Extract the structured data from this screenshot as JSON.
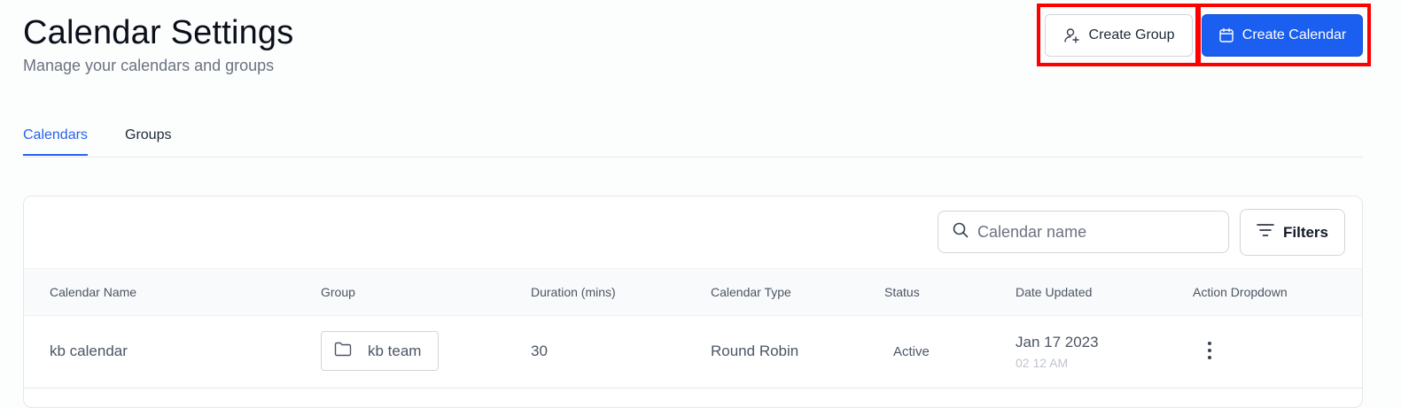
{
  "header": {
    "title": "Calendar Settings",
    "subtitle": "Manage your calendars and groups",
    "create_group_label": "Create Group",
    "create_calendar_label": "Create Calendar"
  },
  "tabs": [
    {
      "label": "Calendars",
      "active": true
    },
    {
      "label": "Groups",
      "active": false
    }
  ],
  "toolbar": {
    "search_placeholder": "Calendar name",
    "filters_label": "Filters"
  },
  "table": {
    "columns": [
      "Calendar Name",
      "Group",
      "Duration (mins)",
      "Calendar Type",
      "Status",
      "Date Updated",
      "Action Dropdown"
    ],
    "rows": [
      {
        "name": "kb calendar",
        "group": "kb team",
        "duration": "30",
        "type": "Round Robin",
        "status": "Active",
        "date": "Jan 17 2023",
        "time": "02 12 AM"
      }
    ]
  },
  "colors": {
    "primary": "#1a5ff0",
    "highlight": "#ff0000",
    "active_tab": "#2563eb"
  },
  "icons": {
    "create_group": "user-plus-icon",
    "create_calendar": "calendar-icon",
    "search": "search-icon",
    "filters": "filter-lines-icon",
    "group": "folder-icon",
    "actions": "kebab-menu-icon"
  }
}
